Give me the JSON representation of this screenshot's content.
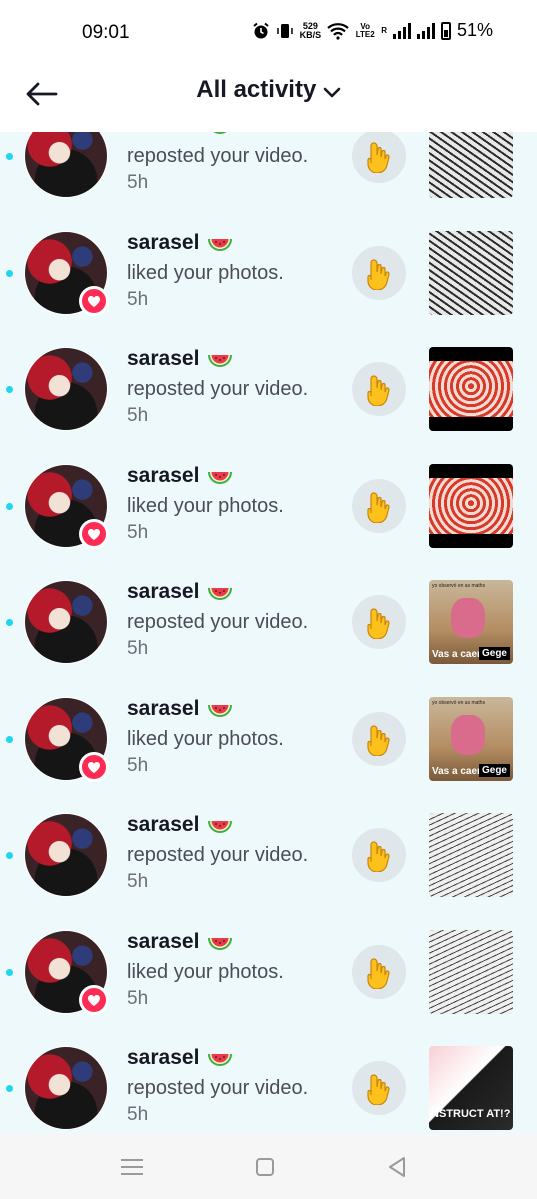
{
  "status_bar": {
    "time": "09:01",
    "net_speed_value": "529",
    "net_speed_unit": "KB/S",
    "volte": "Vo LTE2",
    "signal_label": "R",
    "battery": "51%"
  },
  "header": {
    "title": "All activity"
  },
  "colors": {
    "unread_dot": "#20d5ec",
    "heart_badge": "#fe2c55",
    "list_background": "#eef9fb"
  },
  "notifications": [
    {
      "user": "sarasel",
      "action": "reposted your video.",
      "time": "5h",
      "badge": "none",
      "thumb": "sketch"
    },
    {
      "user": "sarasel",
      "action": "liked your photos.",
      "time": "5h",
      "badge": "heart",
      "thumb": "sketch"
    },
    {
      "user": "sarasel",
      "action": "reposted your video.",
      "time": "5h",
      "badge": "none",
      "thumb": "red"
    },
    {
      "user": "sarasel",
      "action": "liked your photos.",
      "time": "5h",
      "badge": "heart",
      "thumb": "red"
    },
    {
      "user": "sarasel",
      "action": "reposted your video.",
      "time": "5h",
      "badge": "none",
      "thumb": "gege"
    },
    {
      "user": "sarasel",
      "action": "liked your photos.",
      "time": "5h",
      "badge": "heart",
      "thumb": "gege"
    },
    {
      "user": "sarasel",
      "action": "reposted your video.",
      "time": "5h",
      "badge": "none",
      "thumb": "sketch2"
    },
    {
      "user": "sarasel",
      "action": "liked your photos.",
      "time": "5h",
      "badge": "heart",
      "thumb": "sketch2"
    },
    {
      "user": "sarasel",
      "action": "reposted your video.",
      "time": "5h",
      "badge": "none",
      "thumb": "anime"
    }
  ],
  "thumb_text": {
    "gege_caption": "Vas a caer",
    "gege_tag": "Gege",
    "gege_top": "yo observó en as maths",
    "anime_text": "NSTRUCT AT!?"
  },
  "icons": {
    "back": "arrow-left-icon",
    "chevron": "chevron-down-icon",
    "wave": "waving-hand-icon",
    "heart": "heart-icon",
    "emoji": "watermelon-icon",
    "nav_recents": "menu-lines-icon",
    "nav_home": "square-icon",
    "nav_back": "triangle-back-icon"
  }
}
